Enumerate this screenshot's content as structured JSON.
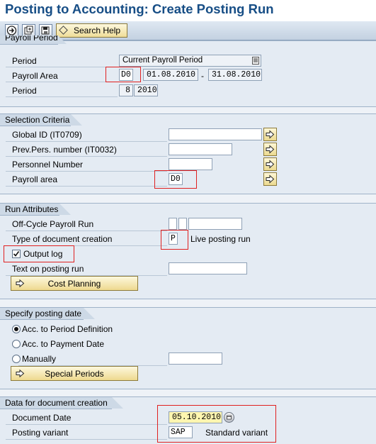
{
  "title": "Posting to Accounting: Create Posting Run",
  "toolbar": {
    "search_help": "Search Help"
  },
  "payroll_period": {
    "header": "Payroll Period",
    "period_label": "Period",
    "period_value": "Current Payroll Period",
    "payroll_area_label": "Payroll Area",
    "payroll_area_value": "D0",
    "date_from": "01.08.2010",
    "date_sep": "-",
    "date_to": "31.08.2010",
    "period2_label": "Period",
    "period_num": "8",
    "period_year": "2010"
  },
  "selection": {
    "header": "Selection Criteria",
    "global_id_label": "Global ID (IT0709)",
    "global_id_value": "",
    "prev_pers_label": "Prev.Pers. number (IT0032)",
    "prev_pers_value": "",
    "personnel_label": "Personnel Number",
    "personnel_value": "",
    "payroll_area_label": "Payroll area",
    "payroll_area_value": "D0"
  },
  "run_attributes": {
    "header": "Run Attributes",
    "offcycle_label": "Off-Cycle Payroll Run",
    "doc_type_label": "Type of document creation",
    "doc_type_value": "P",
    "doc_type_desc": "Live posting run",
    "output_log_label": "Output log",
    "output_log_checked": true,
    "text_label": "Text on posting run",
    "text_value": "",
    "cost_planning": "Cost Planning"
  },
  "posting_date": {
    "header": "Specify posting date",
    "opt1": "Acc. to Period Definition",
    "opt2": "Acc. to Payment Date",
    "opt3": "Manually",
    "selected": "opt1",
    "manual_value": "",
    "special_periods": "Special Periods"
  },
  "doc_creation": {
    "header": "Data for document creation",
    "doc_date_label": "Document Date",
    "doc_date_value": "05.10.2010",
    "variant_label": "Posting variant",
    "variant_value": "SAP",
    "variant_desc": "Standard variant"
  },
  "colors": {
    "title": "#174e86",
    "highlight": "#e02020",
    "date_field": "#fff6b0"
  },
  "icons": [
    "execute-icon",
    "get-variant-icon",
    "save-variant-icon",
    "diamond-icon",
    "multiple-selection-arrow-icon",
    "dropdown-list-icon",
    "calendar-icon"
  ]
}
